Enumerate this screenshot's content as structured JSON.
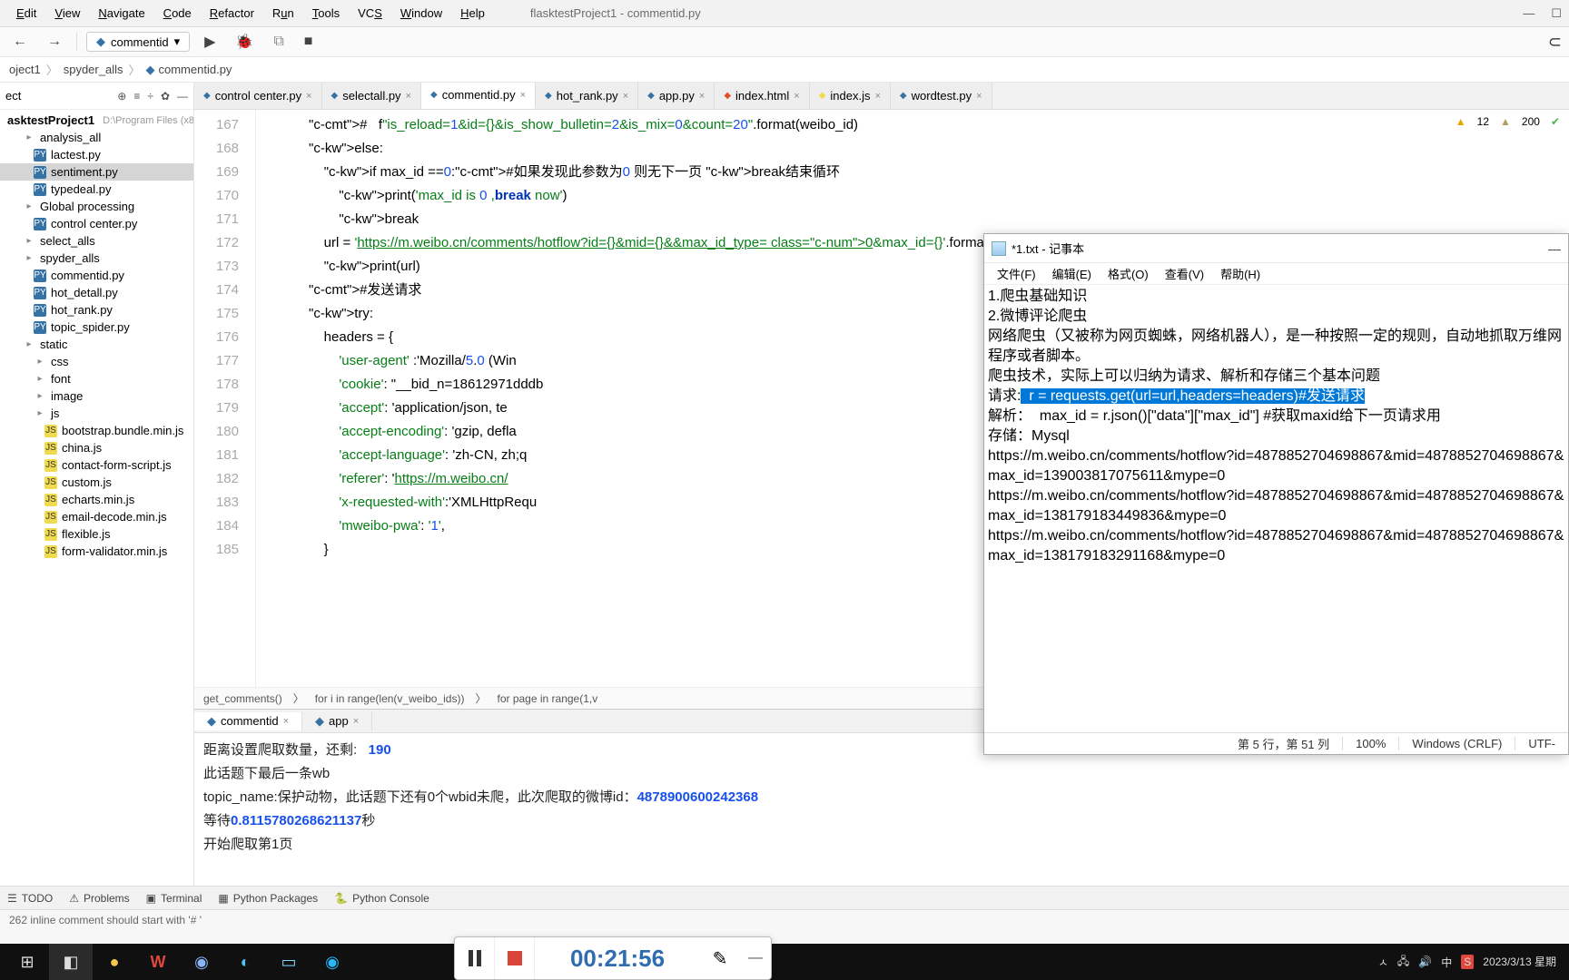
{
  "window_title": "flasktestProject1 - commentid.py",
  "menu": [
    "Edit",
    "View",
    "Navigate",
    "Code",
    "Refactor",
    "Run",
    "Tools",
    "VCS",
    "Window",
    "Help"
  ],
  "run_config": "commentid",
  "breadcrumb": [
    "oject1",
    "spyder_alls",
    "commentid.py"
  ],
  "project": {
    "title": "ect",
    "root": "asktestProject1",
    "root_path": "D:\\Program Files (x8",
    "items": [
      {
        "name": "analysis_all",
        "type": "folder",
        "depth": 1
      },
      {
        "name": "lactest.py",
        "type": "py",
        "depth": 2
      },
      {
        "name": "sentiment.py",
        "type": "py",
        "depth": 2,
        "selected": true
      },
      {
        "name": "typedeal.py",
        "type": "py",
        "depth": 2
      },
      {
        "name": "Global processing",
        "type": "folder",
        "depth": 1
      },
      {
        "name": "control center.py",
        "type": "py",
        "depth": 2
      },
      {
        "name": "select_alls",
        "type": "folder",
        "depth": 1
      },
      {
        "name": "spyder_alls",
        "type": "folder",
        "depth": 1
      },
      {
        "name": "commentid.py",
        "type": "py",
        "depth": 2
      },
      {
        "name": "hot_detall.py",
        "type": "py",
        "depth": 2
      },
      {
        "name": "hot_rank.py",
        "type": "py",
        "depth": 2
      },
      {
        "name": "topic_spider.py",
        "type": "py",
        "depth": 2
      },
      {
        "name": "static",
        "type": "folder",
        "depth": 1
      },
      {
        "name": "css",
        "type": "folder",
        "depth": 2
      },
      {
        "name": "font",
        "type": "folder",
        "depth": 2
      },
      {
        "name": "image",
        "type": "folder",
        "depth": 2
      },
      {
        "name": "js",
        "type": "folder",
        "depth": 2
      },
      {
        "name": "bootstrap.bundle.min.js",
        "type": "js",
        "depth": 3
      },
      {
        "name": "china.js",
        "type": "js",
        "depth": 3
      },
      {
        "name": "contact-form-script.js",
        "type": "js",
        "depth": 3
      },
      {
        "name": "custom.js",
        "type": "js",
        "depth": 3
      },
      {
        "name": "echarts.min.js",
        "type": "js",
        "depth": 3
      },
      {
        "name": "email-decode.min.js",
        "type": "js",
        "depth": 3
      },
      {
        "name": "flexible.js",
        "type": "js",
        "depth": 3
      },
      {
        "name": "form-validator.min.js",
        "type": "js",
        "depth": 3
      }
    ]
  },
  "tabs": [
    {
      "label": "control center.py",
      "type": "py"
    },
    {
      "label": "selectall.py",
      "type": "py"
    },
    {
      "label": "commentid.py",
      "type": "py",
      "active": true
    },
    {
      "label": "hot_rank.py",
      "type": "py"
    },
    {
      "label": "app.py",
      "type": "py"
    },
    {
      "label": "index.html",
      "type": "html"
    },
    {
      "label": "index.js",
      "type": "js"
    },
    {
      "label": "wordtest.py",
      "type": "py"
    }
  ],
  "editor": {
    "first_line": 167,
    "warnings": {
      "hard": "12",
      "soft": "200"
    },
    "lines": [
      "#   f\"is_reload=1&id={}&is_show_bulletin=2&is_mix=0&count=20\".format(weibo_id)",
      "else:",
      "    if max_id ==0:#如果发现此参数为0 则无下一页 break结束循环",
      "        print('max_id is 0 ,break now')",
      "        break",
      "    url = 'https://m.weibo.cn/comments/hotflow?id={}&mid={}&&max_id_type=0&max_id={}'.format(weibo_id,weibo_id,m",
      "    print(url)",
      "#发送请求",
      "try:",
      "    headers = {",
      "        'user-agent' :'Mozilla/5.0 (Win",
      "        'cookie': \"__bid_n=18612971dddb",
      "        'accept': 'application/json, te",
      "        'accept-encoding': 'gzip, defla",
      "        'accept-language': 'zh-CN, zh;q",
      "        'referer': 'https://m.weibo.cn/",
      "        'x-requested-with':'XMLHttpRequ",
      "        'mweibo-pwa': '1',",
      "    }"
    ],
    "crumbs": [
      "get_comments()",
      "for i in range(len(v_weibo_ids))",
      "for page in range(1,v"
    ]
  },
  "console_tabs": [
    {
      "label": "commentid",
      "active": true
    },
    {
      "label": "app"
    }
  ],
  "console_lines": [
    {
      "pre": "距离设置爬取数量，还剩:   ",
      "num": "190",
      "post": ""
    },
    {
      "pre": "此话题下最后一条wb",
      "num": "",
      "post": ""
    },
    {
      "pre": "topic_name:保护动物，此话题下还有0个wbid未爬，此次爬取的微博id：",
      "num": "4878900600242368",
      "post": ""
    },
    {
      "pre": "等待",
      "num": "0.8115780268621137",
      "post": "秒"
    },
    {
      "pre": "开始爬取第1页",
      "num": "",
      "post": ""
    }
  ],
  "tool_tabs": [
    "TODO",
    "Problems",
    "Terminal",
    "Python Packages",
    "Python Console"
  ],
  "status_strip": "262 inline comment should start with '# '",
  "notepad": {
    "title": "*1.txt - 记事本",
    "menu": [
      "文件(F)",
      "编辑(E)",
      "格式(O)",
      "查看(V)",
      "帮助(H)"
    ],
    "lines_pre": [
      "1.爬虫基础知识",
      "2.微博评论爬虫",
      "网络爬虫（又被称为网页蜘蛛，网络机器人），是一种按照一定的规则，自动地抓取万维网程序或者脚本。",
      "爬虫技术，实际上可以归纳为请求、解析和存储三个基本问题"
    ],
    "line_req_pre": "请求:",
    "line_req_hl": "  r = requests.get(url=url,headers=headers)#发送请求",
    "lines_post": [
      "解析：  max_id = r.json()[\"data\"][\"max_id\"] #获取maxid给下一页请求用",
      "存储：Mysql",
      "https://m.weibo.cn/comments/hotflow?id=4878852704698867&mid=4878852704698867&max_id=139003817075611&mype=0",
      "https://m.weibo.cn/comments/hotflow?id=4878852704698867&mid=4878852704698867&max_id=138179183449836&mype=0",
      "https://m.weibo.cn/comments/hotflow?id=4878852704698867&mid=4878852704698867&max_id=138179183291168&mype=0"
    ],
    "status": {
      "pos": "第 5 行，第 51 列",
      "zoom": "100%",
      "eol": "Windows (CRLF)",
      "enc": "UTF-"
    }
  },
  "recorder_time": "00:21:56",
  "taskbar_time": "2023/3/13 星期"
}
